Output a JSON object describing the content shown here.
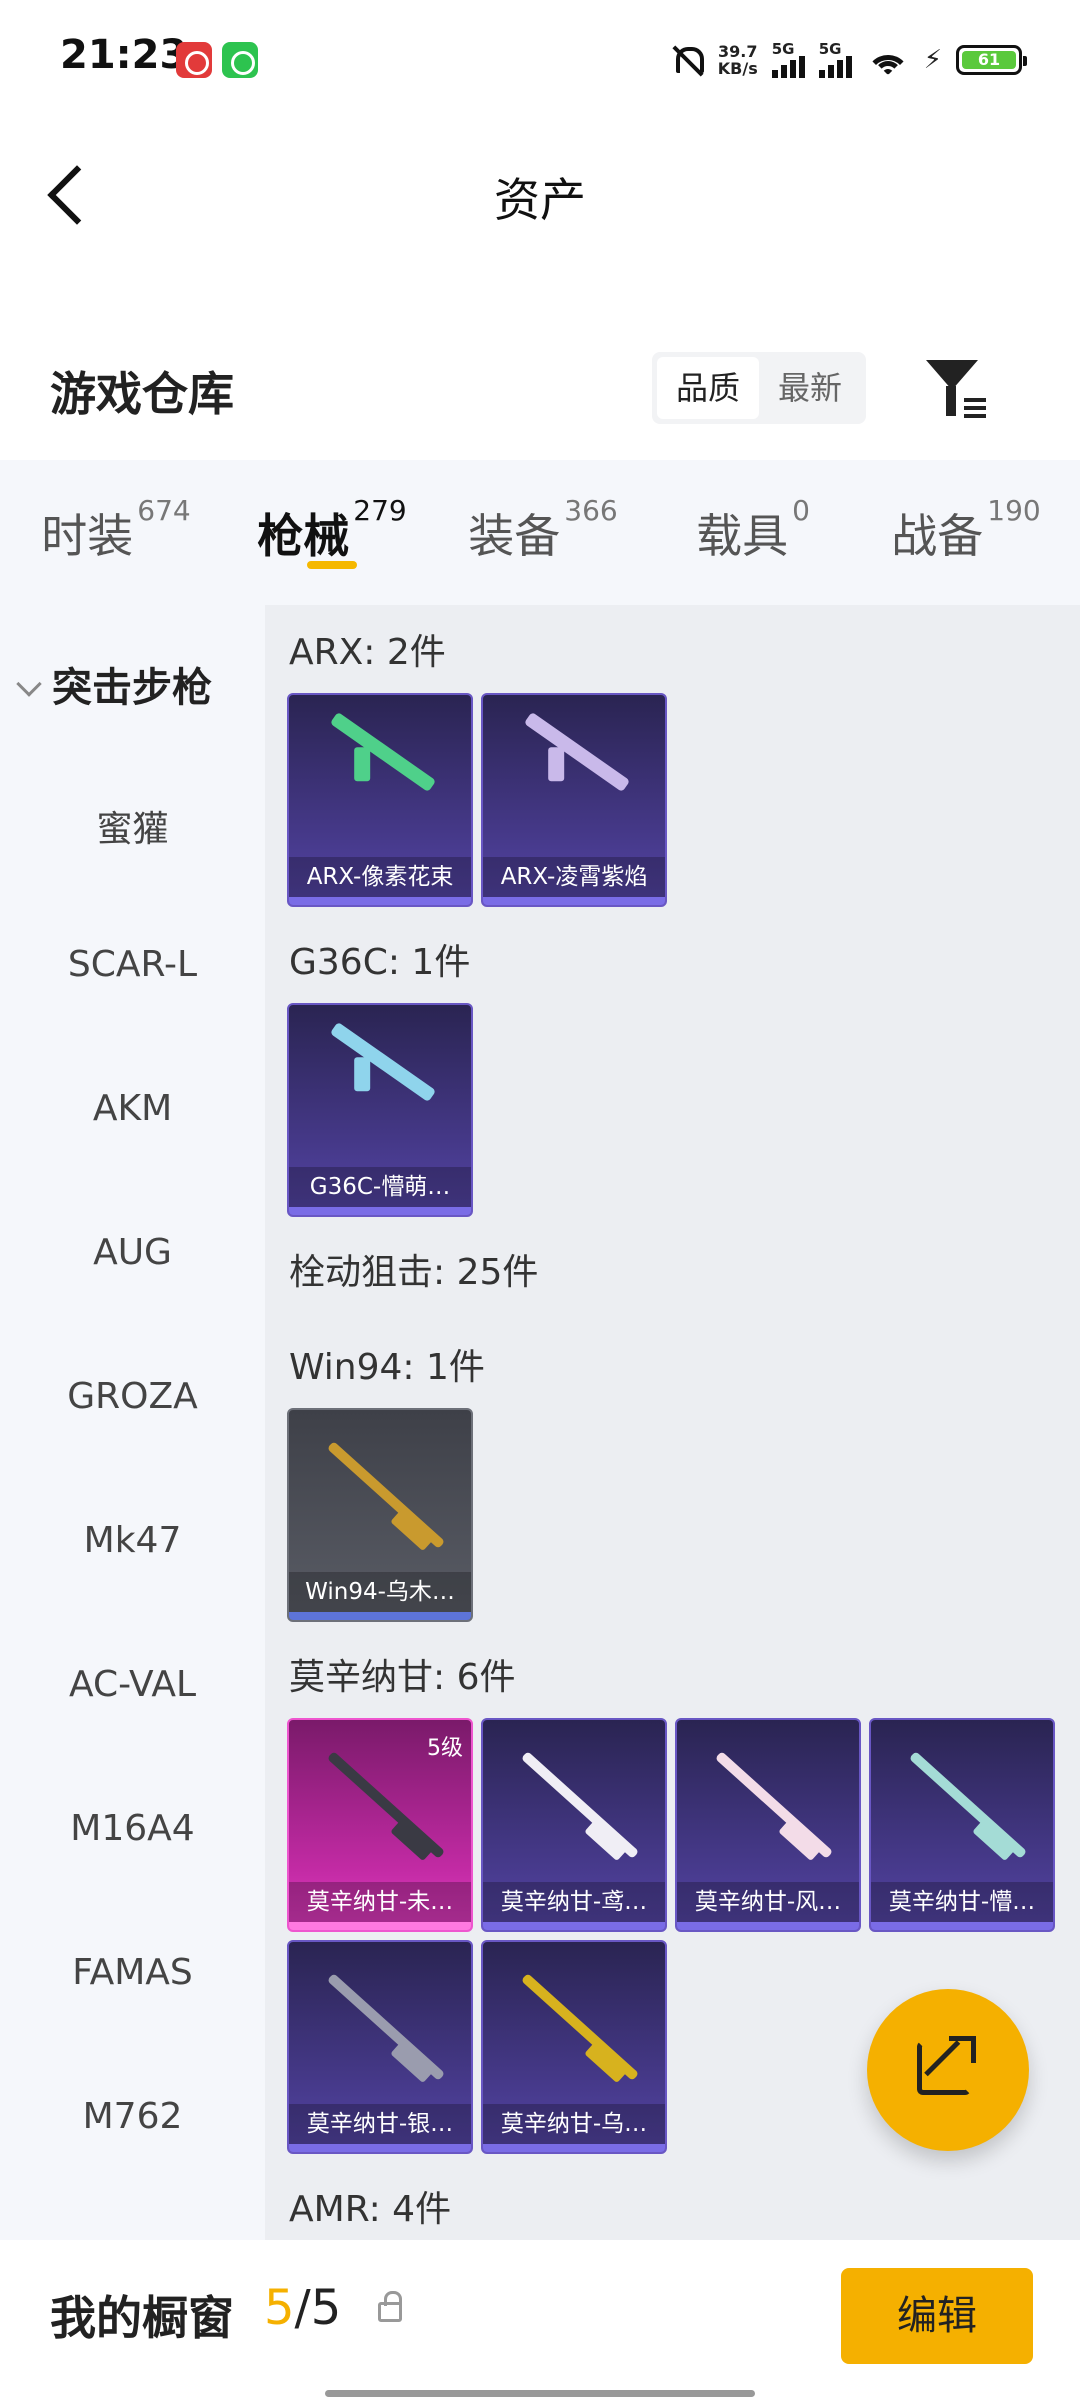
{
  "status_bar": {
    "time": "21:23",
    "speed_value": "39.7",
    "speed_unit": "KB/s",
    "sim1": "5G",
    "sim2": "5G",
    "battery": "61"
  },
  "header": {
    "title": "资产"
  },
  "warehouse": {
    "title": "游戏仓库",
    "sort_options": [
      "品质",
      "最新"
    ],
    "active_sort": "品质"
  },
  "tabs": [
    {
      "label": "时装",
      "count": "674"
    },
    {
      "label": "枪械",
      "count": "279",
      "active": true
    },
    {
      "label": "装备",
      "count": "366"
    },
    {
      "label": "载具",
      "count": "0"
    },
    {
      "label": "战备",
      "count": "190"
    }
  ],
  "sidebar": {
    "category": "突击步枪",
    "items": [
      "蜜獾",
      "SCAR-L",
      "AKM",
      "AUG",
      "GROZA",
      "Mk47",
      "AC-VAL",
      "M16A4",
      "FAMAS",
      "M762"
    ]
  },
  "groups": [
    {
      "title": "ARX: 2件",
      "cards": [
        {
          "name": "ARX-像素花束",
          "style": "purple",
          "gun_color": "#4fd08a"
        },
        {
          "name": "ARX-凌霄紫焰",
          "style": "purple",
          "gun_color": "#c9b9ea"
        }
      ]
    },
    {
      "title": "G36C: 1件",
      "cards": [
        {
          "name": "G36C-懵萌…",
          "style": "purple",
          "gun_color": "#8fd4ec"
        }
      ]
    },
    {
      "title": "栓动狙击: 25件",
      "cards": []
    },
    {
      "title": "Win94: 1件",
      "cards": [
        {
          "name": "Win94-乌木…",
          "style": "gray",
          "gun_color": "#c99a2e"
        }
      ]
    },
    {
      "title": "莫辛纳甘: 6件",
      "cards": [
        {
          "name": "莫辛纳甘-未…",
          "style": "pink",
          "gun_color": "#3a3a44",
          "level": "5级"
        },
        {
          "name": "莫辛纳甘-鸢…",
          "style": "purple",
          "gun_color": "#f0eef5"
        },
        {
          "name": "莫辛纳甘-风…",
          "style": "purple",
          "gun_color": "#f3dce8"
        },
        {
          "name": "莫辛纳甘-懵…",
          "style": "purple",
          "gun_color": "#a4dcd6"
        },
        {
          "name": "莫辛纳甘-银…",
          "style": "purple",
          "gun_color": "#9a9cae"
        },
        {
          "name": "莫辛纳甘-乌…",
          "style": "purple",
          "gun_color": "#d7b21e"
        }
      ]
    },
    {
      "title": "AMR: 4件",
      "cards": []
    }
  ],
  "showcase": {
    "label": "我的橱窗",
    "current": "5",
    "sep": "/",
    "total": "5",
    "edit_label": "编辑"
  },
  "colors": {
    "accent": "#f5b000"
  }
}
